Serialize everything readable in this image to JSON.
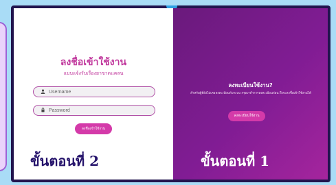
{
  "login": {
    "title": "ลงชื่อเข้าใช้งาน",
    "subtitle": "แบบแจ้งรับเรื่องยาขาดแคลน",
    "username_placeholder": "Username",
    "password_placeholder": "Password",
    "submit_label": "ลงชื่อเข้าใช้งาน",
    "username_icon": "user-icon",
    "password_icon": "lock-icon"
  },
  "register": {
    "title": "ลงทะเบียนใช้งาน?",
    "description": "สำหรับผู้ที่ยังไม่เคยลงทะเบียนกับระบบ กรุณาทำการลงทะเบียนก่อน ถึงจะลงชื่อเข้าใช้งานได้",
    "button_label": "ลงทะเบียนใช้งาน"
  },
  "steps": {
    "left_label": "ขั้นตอนที่ 2",
    "right_label": "ขั้นตอนที่ 1"
  },
  "colors": {
    "accent": "#d43aa9",
    "title": "#c0379c",
    "panel_gradient_start": "#6a1a7c",
    "panel_gradient_end": "#a5259d",
    "frame": "#21144e",
    "background": "#a9dcf6"
  }
}
